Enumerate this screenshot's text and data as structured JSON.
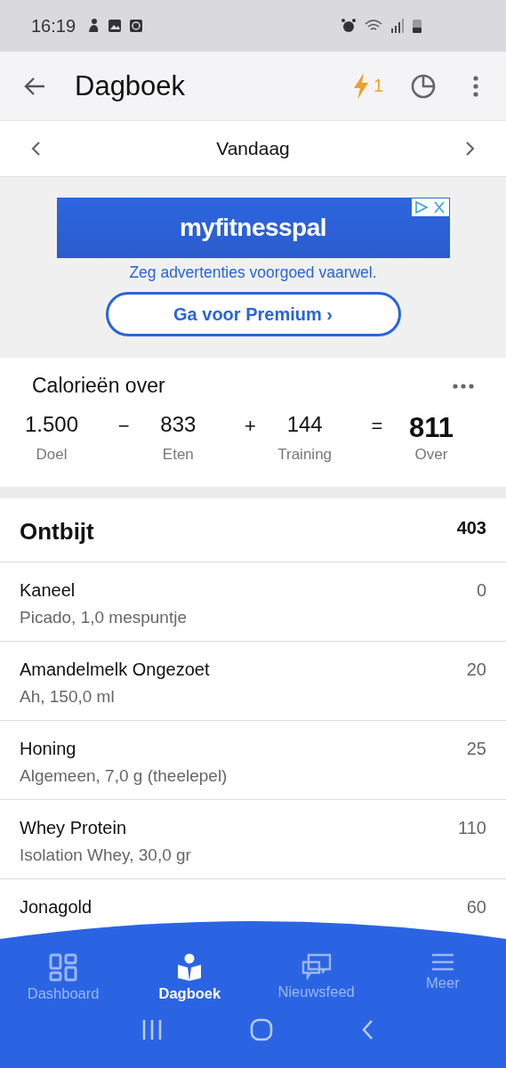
{
  "status_bar": {
    "time": "16:19"
  },
  "app_bar": {
    "title": "Dagboek",
    "streak": "1"
  },
  "date_nav": {
    "label": "Vandaag"
  },
  "ad": {
    "brand": "myfitnesspal",
    "tagline": "Zeg advertenties voorgoed vaarwel.",
    "button": "Ga voor Premium ›"
  },
  "calories": {
    "title": "Calorieën over",
    "terms": [
      {
        "value": "1.500",
        "label": "Doel",
        "operator": "−"
      },
      {
        "value": "833",
        "label": "Eten",
        "operator": "+"
      },
      {
        "value": "144",
        "label": "Training",
        "operator": "="
      },
      {
        "value": "811",
        "label": "Over",
        "kind": "result"
      }
    ]
  },
  "meal": {
    "name": "Ontbijt",
    "total": "403",
    "items": [
      {
        "name": "Kaneel",
        "detail": "Picado, 1,0 mespuntje",
        "calories": "0"
      },
      {
        "name": "Amandelmelk Ongezoet",
        "detail": "Ah, 150,0 ml",
        "calories": "20"
      },
      {
        "name": "Honing",
        "detail": "Algemeen, 7,0 g (theelepel)",
        "calories": "25"
      },
      {
        "name": "Whey Protein",
        "detail": "Isolation Whey, 30,0 gr",
        "calories": "110"
      },
      {
        "name": "Jonagold",
        "calories": "60"
      }
    ]
  },
  "bottom_nav": [
    {
      "label": "Dashboard",
      "selected": false
    },
    {
      "label": "Dagboek",
      "selected": true
    },
    {
      "label": "Nieuwsfeed",
      "selected": false
    },
    {
      "label": "Meer",
      "selected": false
    }
  ]
}
